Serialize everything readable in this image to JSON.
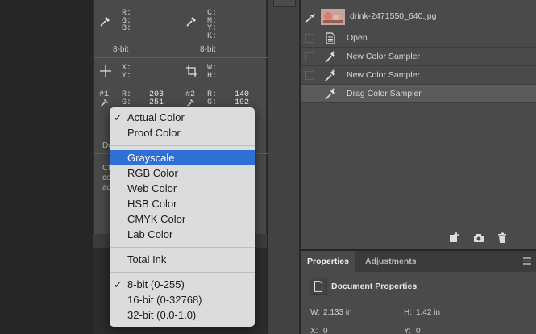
{
  "info": {
    "rgb_labels": "R:\nG:\nB:",
    "cmyk_labels": "C:\nM:\nY:\nK:",
    "bit_depth_left": "8-bit",
    "bit_depth_right": "8-bit",
    "xy_labels": "X:\nY:",
    "wh_labels": "W:\nH:",
    "sampler1": {
      "id": "#1",
      "labels": "R:\nG:",
      "values": "203\n251"
    },
    "sampler2": {
      "id": "#2",
      "labels": "R:\nG:",
      "values": "140\n192"
    },
    "behind_doc": "Do",
    "behind_text": "Cli\nco\nac"
  },
  "history": {
    "snapshot_name": "drink-2471550_640.jpg",
    "items": [
      {
        "label": "Open",
        "icon": "document-icon"
      },
      {
        "label": "New Color Sampler",
        "icon": "color-sampler-icon"
      },
      {
        "label": "New Color Sampler",
        "icon": "color-sampler-icon"
      },
      {
        "label": "Drag Color Sampler",
        "icon": "color-sampler-icon"
      }
    ]
  },
  "properties": {
    "tabs": [
      "Properties",
      "Adjustments"
    ],
    "section_title": "Document Properties",
    "w_label": "W:",
    "w_value": "2.133 in",
    "h_label": "H:",
    "h_value": "1.42 in",
    "x_label": "X:",
    "x_value": "0",
    "y_label": "Y:",
    "y_value": "0"
  },
  "dropdown": {
    "group1": [
      {
        "label": "Actual Color",
        "checked": "✓"
      },
      {
        "label": "Proof Color",
        "checked": ""
      }
    ],
    "group2": [
      {
        "label": "Grayscale",
        "checked": ""
      },
      {
        "label": "RGB Color",
        "checked": ""
      },
      {
        "label": "Web Color",
        "checked": ""
      },
      {
        "label": "HSB Color",
        "checked": ""
      },
      {
        "label": "CMYK Color",
        "checked": ""
      },
      {
        "label": "Lab Color",
        "checked": ""
      }
    ],
    "group3": [
      {
        "label": "Total Ink",
        "checked": ""
      }
    ],
    "group4": [
      {
        "label": "8-bit (0-255)",
        "checked": "✓"
      },
      {
        "label": "16-bit (0-32768)",
        "checked": ""
      },
      {
        "label": "32-bit (0.0-1.0)",
        "checked": ""
      }
    ],
    "highlight_color": "#2f6fd6"
  }
}
